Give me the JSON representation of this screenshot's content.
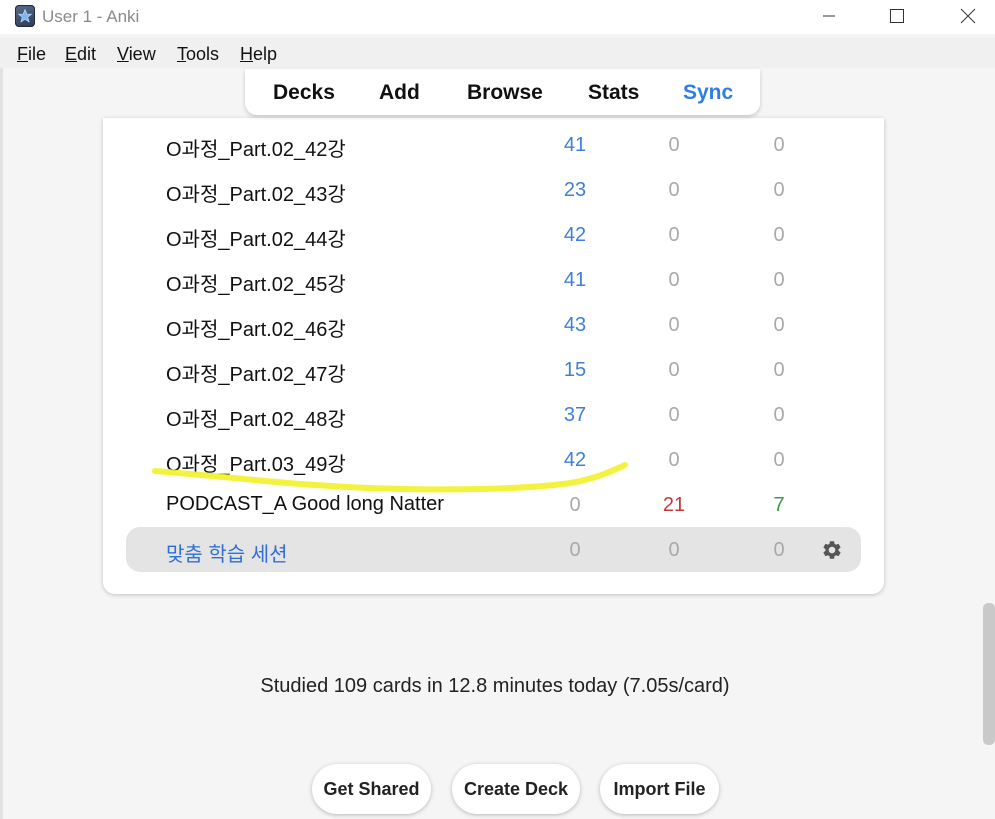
{
  "window": {
    "title": "User 1 - Anki"
  },
  "menu": {
    "items": [
      {
        "label": "File"
      },
      {
        "label": "Edit"
      },
      {
        "label": "View"
      },
      {
        "label": "Tools"
      },
      {
        "label": "Help"
      }
    ]
  },
  "toolbar": {
    "decks": "Decks",
    "add": "Add",
    "browse": "Browse",
    "stats": "Stats",
    "sync": "Sync",
    "sync_color": "#2f7ee4"
  },
  "decks": [
    {
      "name": "O과정_Part.02_42강",
      "new": "41",
      "learn": "0",
      "due": "0"
    },
    {
      "name": "O과정_Part.02_43강",
      "new": "23",
      "learn": "0",
      "due": "0"
    },
    {
      "name": "O과정_Part.02_44강",
      "new": "42",
      "learn": "0",
      "due": "0"
    },
    {
      "name": "O과정_Part.02_45강",
      "new": "41",
      "learn": "0",
      "due": "0"
    },
    {
      "name": "O과정_Part.02_46강",
      "new": "43",
      "learn": "0",
      "due": "0"
    },
    {
      "name": "O과정_Part.02_47강",
      "new": "15",
      "learn": "0",
      "due": "0"
    },
    {
      "name": "O과정_Part.02_48강",
      "new": "37",
      "learn": "0",
      "due": "0"
    },
    {
      "name": "O과정_Part.03_49강",
      "new": "42",
      "learn": "0",
      "due": "0"
    },
    {
      "name": "PODCAST_A Good long Natter",
      "new": "0",
      "learn": "21",
      "due": "7"
    },
    {
      "name": "맞춤 학습 세션",
      "new": "0",
      "learn": "0",
      "due": "0"
    }
  ],
  "colors": {
    "new": "#3f7fdb",
    "learn": "#c53838",
    "due": "#3c9a4a",
    "zero": "#a9a9a9",
    "annotation": "#f2f22a"
  },
  "stats": {
    "text": "Studied 109 cards in 12.8 minutes today (7.05s/card)"
  },
  "bottom": {
    "get_shared": "Get Shared",
    "create_deck": "Create Deck",
    "import_file": "Import File"
  }
}
